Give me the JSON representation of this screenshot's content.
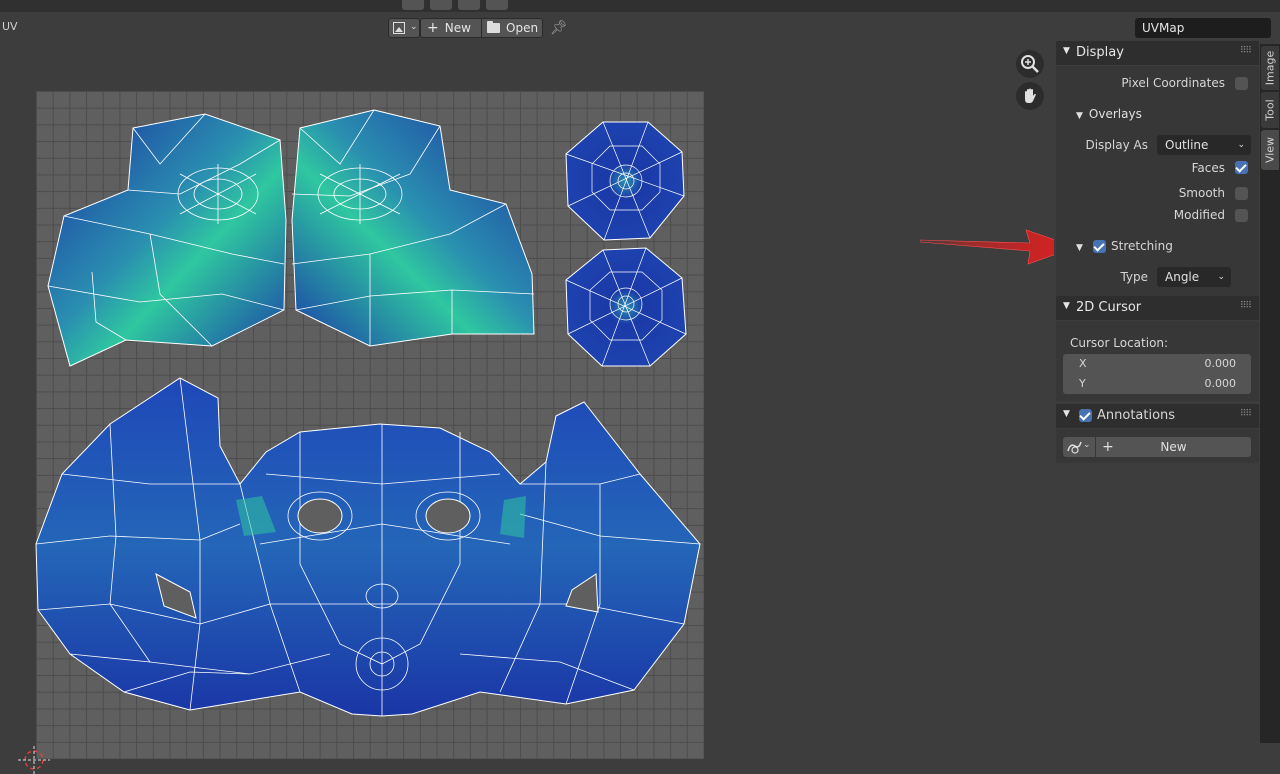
{
  "header": {
    "editor_label": "UV",
    "new_label": "New",
    "open_label": "Open",
    "uvmap_name": "UVMap"
  },
  "tabs": {
    "image": "Image",
    "tool": "Tool",
    "view": "View"
  },
  "display": {
    "title": "Display",
    "pixel_coordinates": "Pixel Coordinates",
    "overlays": {
      "title": "Overlays",
      "display_as_label": "Display As",
      "display_as_value": "Outline",
      "faces": "Faces",
      "smooth": "Smooth",
      "modified": "Modified"
    },
    "stretching": {
      "title": "Stretching",
      "type_label": "Type",
      "type_value": "Angle"
    }
  },
  "cursor2d": {
    "title": "2D Cursor",
    "location_label": "Cursor Location:",
    "x_label": "X",
    "x_value": "0.000",
    "y_label": "Y",
    "y_value": "0.000"
  },
  "annotations": {
    "title": "Annotations",
    "new_label": "New"
  },
  "colors": {
    "accent": "#4772b3",
    "arrow": "#e02020",
    "uv_fill": "#1f3fa8"
  }
}
